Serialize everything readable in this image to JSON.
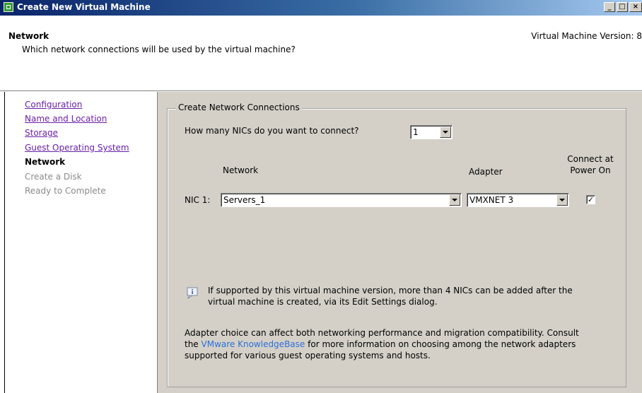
{
  "window": {
    "title": "Create New Virtual Machine",
    "controls": [
      "_",
      "□",
      "×"
    ]
  },
  "header": {
    "title": "Network",
    "subtitle": "Which network connections will be used by the virtual machine?",
    "version_text": "Virtual Machine Version: 8"
  },
  "nav": {
    "items": [
      {
        "label": "Configuration",
        "state": "link"
      },
      {
        "label": "Name and Location",
        "state": "link"
      },
      {
        "label": "Storage",
        "state": "link"
      },
      {
        "label": "Guest Operating System",
        "state": "link"
      },
      {
        "label": "Network",
        "state": "current"
      },
      {
        "label": "Create a Disk",
        "state": "disabled"
      },
      {
        "label": "Ready to Complete",
        "state": "disabled"
      }
    ]
  },
  "group": {
    "label": "Create Network Connections",
    "nics_question": "How many NICs do you want to connect?",
    "nics_value": "1",
    "col_network": "Network",
    "col_adapter": "Adapter",
    "col_connect": "Connect at Power On",
    "col_connect_line1": "Connect at",
    "col_connect_line2": "Power On",
    "nic_label": "NIC 1:",
    "network_value": "Servers_1",
    "adapter_value": "VMXNET 3",
    "connect_checked": true,
    "connect_mark": "✓",
    "info_line1": "If supported by this virtual machine version, more than 4 NICs can be added after the",
    "info_line2": "virtual machine is created, via its Edit Settings dialog.",
    "note_line1": "Adapter choice can affect both networking performance and migration compatibility. Consult",
    "note_the": "the ",
    "note_link": "VMware KnowledgeBase",
    "note_line2_rest": " for more information on choosing among the network adapters",
    "note_line3": "supported for various guest operating systems and hosts."
  },
  "colors": {
    "titlebar_start": "#0a246a",
    "titlebar_end": "#a6caf0",
    "link": "#6a1fa8",
    "kb_link": "#2b6fd6",
    "panel": "#d4d0c8"
  }
}
